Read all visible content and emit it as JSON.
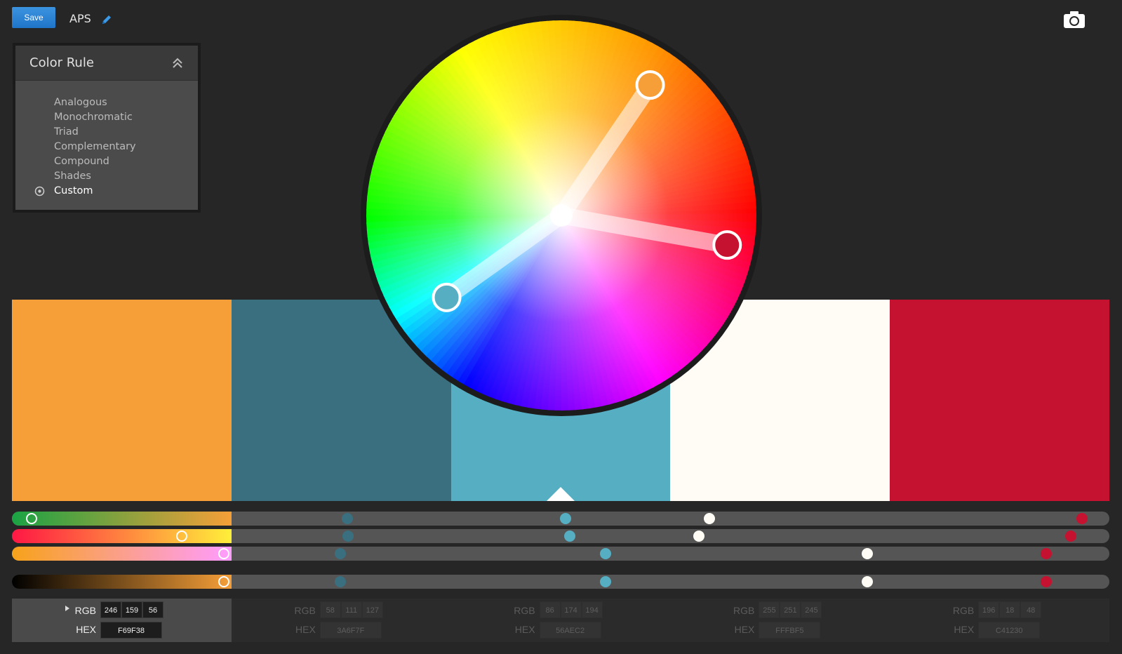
{
  "toolbar": {
    "save_label": "Save",
    "theme_name": "APS"
  },
  "color_rule": {
    "title": "Color Rule",
    "options": [
      {
        "label": "Analogous",
        "selected": false
      },
      {
        "label": "Monochromatic",
        "selected": false
      },
      {
        "label": "Triad",
        "selected": false
      },
      {
        "label": "Complementary",
        "selected": false
      },
      {
        "label": "Compound",
        "selected": false
      },
      {
        "label": "Shades",
        "selected": false
      },
      {
        "label": "Custom",
        "selected": true
      }
    ]
  },
  "swatches": [
    {
      "hex": "F69F38",
      "rgb": [
        246,
        159,
        56
      ],
      "active": true
    },
    {
      "hex": "3A6F7F",
      "rgb": [
        58,
        111,
        127
      ],
      "active": false
    },
    {
      "hex": "56AEC2",
      "rgb": [
        86,
        174,
        194
      ],
      "active": false
    },
    {
      "hex": "FFFBF5",
      "rgb": [
        255,
        251,
        245
      ],
      "active": false
    },
    {
      "hex": "C41230",
      "rgb": [
        196,
        18,
        48
      ],
      "active": false
    }
  ],
  "active_swatch_index": 2,
  "labels": {
    "rgb": "RGB",
    "hex": "HEX"
  },
  "colors": {
    "background": "#262626",
    "save_button": "#2f86d6",
    "swatch_1": "#F69F38",
    "swatch_2": "#3A6F7F",
    "swatch_3": "#56AEC2",
    "swatch_4": "#FFFBF5",
    "swatch_5": "#C41230"
  },
  "icons": {
    "edit": "pencil-icon",
    "snapshot": "camera-icon",
    "collapse": "double-chevron-up-icon",
    "radio": "radio-selected-icon",
    "expand": "triangle-right-icon"
  }
}
